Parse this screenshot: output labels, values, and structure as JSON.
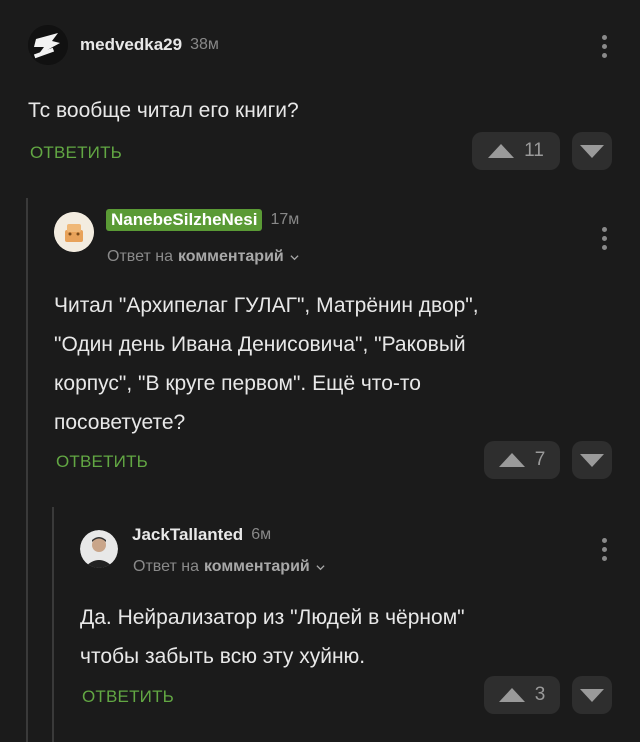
{
  "comments": [
    {
      "username": "medvedka29",
      "time": "38м",
      "text": "Тс вообще читал его книги?",
      "reply_label": "ОТВЕТИТЬ",
      "votes": "11"
    },
    {
      "username": "NanebeSilzheNesi",
      "time": "17м",
      "reply_prefix": "Ответ на",
      "reply_target": "комментарий",
      "text_lines": [
        "Читал \"Архипелаг ГУЛАГ\", Матрёнин двор\",",
        "\"Один день Ивана Денисовича\", \"Раковый",
        "корпус\", \"В круге первом\". Ещё что-то",
        "посоветуете?"
      ],
      "reply_label": "ОТВЕТИТЬ",
      "votes": "7"
    },
    {
      "username": "JackTallanted",
      "time": "6м",
      "reply_prefix": "Ответ на",
      "reply_target": "комментарий",
      "text_lines": [
        "Да. Нейрализатор из \"Людей в чёрном\"",
        "чтобы забыть всю эту хуйню."
      ],
      "reply_label": "ОТВЕТИТЬ",
      "votes": "3"
    }
  ],
  "icons": {
    "more": "more-vertical-icon",
    "upvote": "triangle-up-icon",
    "downvote": "triangle-down-icon",
    "expand": "chevron-down-icon"
  },
  "colors": {
    "background": "#1b1b1b",
    "accent": "#62a743",
    "username_highlight": "#5a9a35",
    "button_bg": "#2e2e2e"
  }
}
